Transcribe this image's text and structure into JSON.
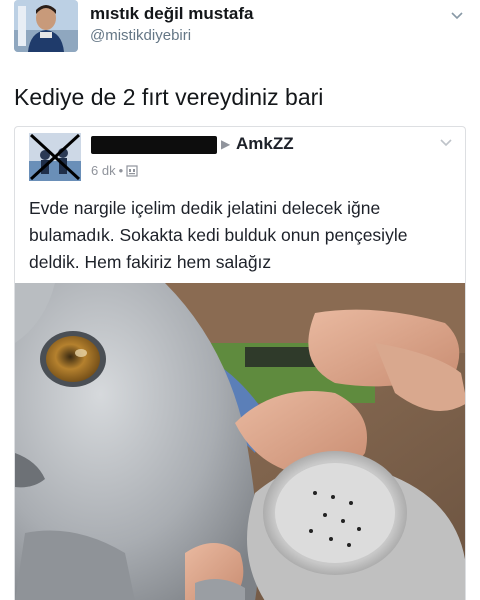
{
  "tweet": {
    "display_name": "mıstık değil mustafa",
    "handle": "@mistikdiyebiri",
    "text": "Kediye de 2 fırt vereydiniz bari"
  },
  "embedded_post": {
    "group_name": "AmkZZ",
    "time": "6 dk",
    "separator": "•",
    "text": "Evde nargile içelim dedik jelatini delecek iğne bulamadık. Sokakta kedi bulduk onun pençesiyle deldik. Hem fakiriz hem salağız"
  },
  "colors": {
    "text_primary": "#14171a",
    "text_secondary": "#657786",
    "fb_meta": "#90949c",
    "card_border": "#dddfe2"
  },
  "icons": {
    "tweet_caret": "chevron-down-icon",
    "fb_caret": "chevron-down-icon",
    "fb_arrow": "triangle-right-icon",
    "fb_privacy": "group-privacy-icon"
  }
}
